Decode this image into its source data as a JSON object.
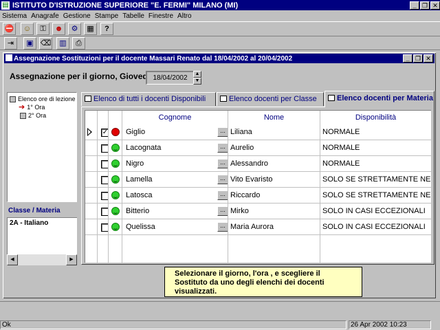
{
  "app": {
    "title": "ISTITUTO D'ISTRUZIONE SUPERIORE \"E. FERMI\" MILANO (MI)",
    "window_buttons": [
      "_",
      "❐",
      "✕"
    ]
  },
  "menu": [
    "Sistema",
    "Anagrafe",
    "Gestione",
    "Stampe",
    "Tabelle",
    "Finestre",
    "Altro"
  ],
  "toolbar": {
    "row1": [
      "stop-icon",
      "people-icon",
      "key-icon",
      "person-icon",
      "tool-icon",
      "grid-icon",
      "help-icon"
    ],
    "row1_glyphs": [
      "⛔",
      "☺",
      "⚿",
      "☻",
      "⚙",
      "▦",
      "?"
    ],
    "row2": [
      "exit-icon",
      "save-icon",
      "delete-icon",
      "chart-icon",
      "print-icon"
    ],
    "row2_glyphs": [
      "⇥",
      "▣",
      "⌫",
      "▥",
      "⎙"
    ]
  },
  "child": {
    "title": "Assegnazione Sostituzioni per il docente Massari Renato dal 18/04/2002 al 20/04/2002",
    "window_buttons": [
      "_",
      "❐",
      "✕"
    ],
    "assign_label": "Assegnazione per il giorno, Giovedì",
    "date_value": "18/04/2002",
    "spin_up": "▲",
    "spin_down": "▼"
  },
  "tree": {
    "root": "Elenco ore di lezione",
    "items": [
      "1° Ora",
      "2° Ora"
    ],
    "pointer": "➔"
  },
  "classes": {
    "label": "Classe / Materia",
    "items": [
      "2A - Italiano"
    ],
    "scroll_left": "◀",
    "scroll_right": "▶"
  },
  "tabs": [
    {
      "label": "Elenco di tutti i docenti Disponibili"
    },
    {
      "label": "Elenco docenti per Classe"
    },
    {
      "label": "Elenco docenti per Materia"
    }
  ],
  "grid": {
    "columns": [
      "Cognome",
      "Nome",
      "Disponibilità"
    ],
    "ellipsis": "...",
    "rows": [
      {
        "checked": true,
        "status": "red",
        "cognome": "Giglio",
        "nome": "Liliana",
        "disp": "NORMALE"
      },
      {
        "checked": false,
        "status": "green",
        "cognome": "Lacognata",
        "nome": "Aurelio",
        "disp": "NORMALE"
      },
      {
        "checked": false,
        "status": "green",
        "cognome": "Nigro",
        "nome": "Alessandro",
        "disp": "NORMALE"
      },
      {
        "checked": false,
        "status": "green",
        "cognome": "Lamella",
        "nome": "Vito Evaristo",
        "disp": "SOLO SE STRETTAMENTE NEC"
      },
      {
        "checked": false,
        "status": "green",
        "cognome": "Latosca",
        "nome": "Riccardo",
        "disp": "SOLO SE STRETTAMENTE NEC"
      },
      {
        "checked": false,
        "status": "green",
        "cognome": "Bitterio",
        "nome": "Mirko",
        "disp": "SOLO IN CASI ECCEZIONALI"
      },
      {
        "checked": false,
        "status": "green",
        "cognome": "Quelissa",
        "nome": "Maria Aurora",
        "disp": "SOLO IN CASI ECCEZIONALI"
      }
    ]
  },
  "hint": "Selezionare il giorno, l'ora , e scegliere il Sostituto da uno degli elenchi dei docenti visualizzati.",
  "status": {
    "left": "Ok",
    "right": "26 Apr 2002 10:23"
  },
  "colors": {
    "titlebar": "#000080",
    "status_red": "#e00000",
    "status_green": "#30d030",
    "hint_bg": "#ffffc0"
  }
}
